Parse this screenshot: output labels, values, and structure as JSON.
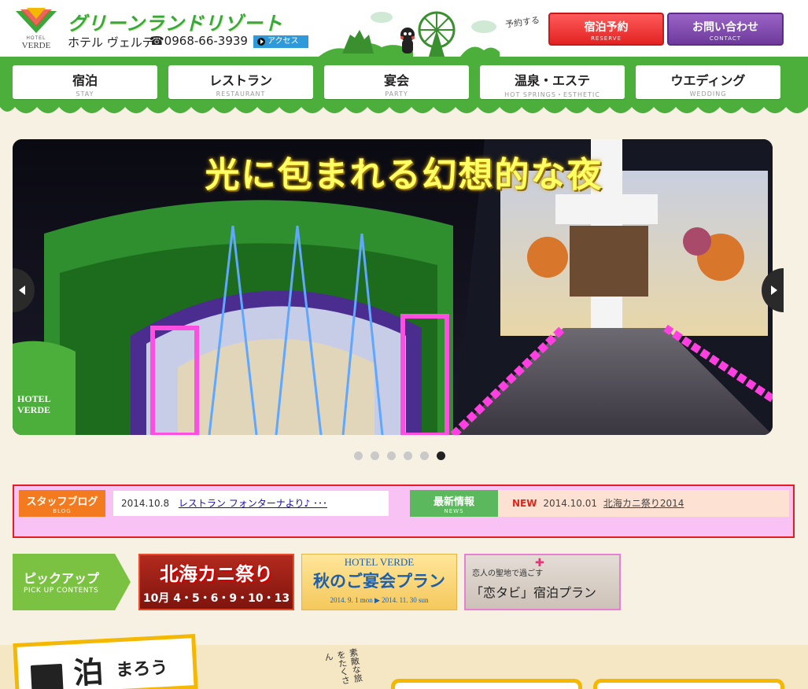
{
  "header": {
    "logo_hotel": "HOTEL",
    "logo_verde": "VERDE",
    "brand_title": "グリーンランドリゾート",
    "hotel_name": "ホテル ヴェルデ",
    "tel": "☎0968-66-3939",
    "access_label": "アクセス",
    "reserve_note": "予約する",
    "reserve_button": {
      "label": "宿泊予約",
      "sub": "RESERVE"
    },
    "contact_button": {
      "label": "お問い合わせ",
      "sub": "CONTACT"
    }
  },
  "nav": {
    "items": [
      {
        "label": "宿泊",
        "sub": "STAY"
      },
      {
        "label": "レストラン",
        "sub": "RESTAURANT"
      },
      {
        "label": "宴会",
        "sub": "PARTY"
      },
      {
        "label": "温泉・エステ",
        "sub": "HOT SPRINGS・ESTHETIC"
      },
      {
        "label": "ウエディング",
        "sub": "WEDDING"
      }
    ]
  },
  "hero": {
    "caption": "光に包まれる幻想的な夜",
    "logo_line1": "HOTEL",
    "logo_line2": "VERDE",
    "slide_count": 6,
    "active_slide": 6
  },
  "info": {
    "blog_label": "スタッフブログ",
    "blog_sub": "BLOG",
    "blog_date": "2014.10.8",
    "blog_title": "レストラン フォンターナより♪ ･･･",
    "news_label": "最新情報",
    "news_sub": "NEWS",
    "news_new": "NEW",
    "news_date": "2014.10.01",
    "news_title": "北海カニ祭り2014"
  },
  "pickup": {
    "label": "ピックアップ",
    "sub": "PICK UP CONTENTS",
    "banners": [
      {
        "title": "北海カニ祭り",
        "subtitle": "10月 4・5・6・9・10・13"
      },
      {
        "title_top": "HOTEL VERDE",
        "title": "秋のご宴会プラン",
        "subtitle": "2014. 9. 1 mon ▶ 2014. 11. 30 sun"
      },
      {
        "tagline": "恋人の聖地で過ごす",
        "title": "「恋タビ」宿泊プラン"
      }
    ]
  },
  "stay": {
    "kanji": "泊",
    "rest": "まろう",
    "vertical_note": "素敵な旅をたくさん"
  },
  "colors": {
    "nav_green": "#4caf3c",
    "reserve_red": "#e32222",
    "contact_purple": "#6d3a9c",
    "blog_orange": "#f47a1f",
    "news_green": "#5cb85c",
    "info_border": "#e51c23"
  }
}
